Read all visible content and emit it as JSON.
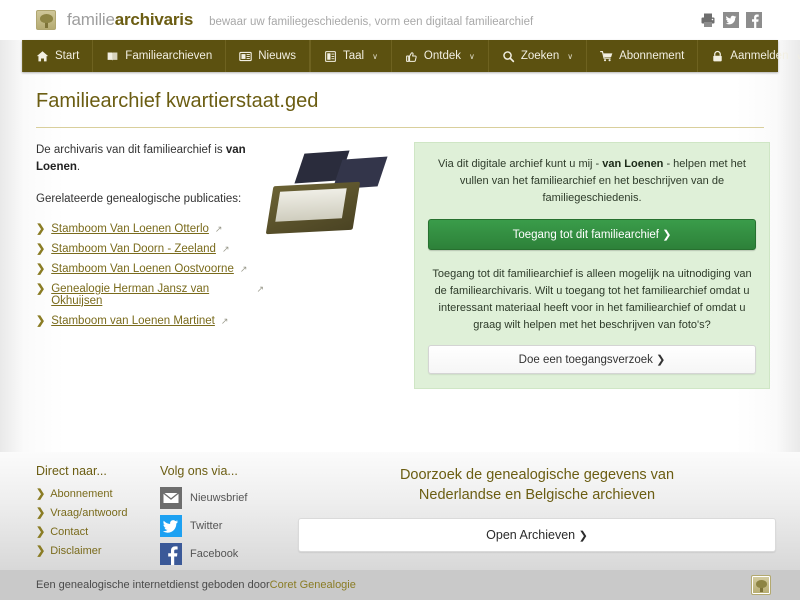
{
  "header": {
    "logo_icon": "tree-logo-icon",
    "brand_light": "familie",
    "brand_bold": "archivaris",
    "tagline": "bewaar uw familiegeschiedenis, vorm een digitaal familiearchief",
    "social": [
      {
        "name": "print-icon",
        "label": "Print"
      },
      {
        "name": "twitter-icon",
        "label": "Twitter"
      },
      {
        "name": "facebook-icon",
        "label": "Facebook"
      }
    ]
  },
  "nav": {
    "left": [
      {
        "icon": "home-icon",
        "label": "Start",
        "caret": false
      },
      {
        "icon": "book-icon",
        "label": "Familiearchieven",
        "caret": false
      },
      {
        "icon": "news-icon",
        "label": "Nieuws",
        "caret": false
      }
    ],
    "right": [
      {
        "icon": "language-icon",
        "label": "Taal",
        "caret": true
      },
      {
        "icon": "thumbs-up-icon",
        "label": "Ontdek",
        "caret": true
      },
      {
        "icon": "search-icon",
        "label": "Zoeken",
        "caret": true
      },
      {
        "icon": "cart-icon",
        "label": "Abonnement",
        "caret": false
      },
      {
        "icon": "lock-icon",
        "label": "Aanmelden",
        "caret": true
      }
    ],
    "caret_glyph": "∨"
  },
  "page_title": "Familiearchief kwartierstaat.ged",
  "left_column": {
    "intro_prefix": "De archivaris van dit familiearchief is ",
    "intro_strong": "van Loenen",
    "intro_suffix": ".",
    "publications_heading": "Gerelateerde genealogische publicaties:",
    "links": [
      "Stamboom Van Loenen Otterlo",
      "Stamboom Van Doorn - Zeeland",
      "Stamboom Van Loenen Oostvoorne",
      "Genealogie Herman Jansz van Okhuijsen",
      "Stamboom van Loenen Martinet"
    ],
    "chevron_glyph": "❯",
    "external_glyph": "↗"
  },
  "photo": {
    "alt": "archive-box-photo"
  },
  "panel": {
    "intro_prefix": "Via dit digitale archief kunt u mij - ",
    "intro_strong": "van Loenen",
    "intro_suffix": " - helpen met het vullen van het familiearchief en het beschrijven van de familiegeschiedenis.",
    "primary_button": "Toegang tot dit familiearchief",
    "body_text": "Toegang tot dit familiearchief is alleen mogelijk na uitnodiging van de familiearchivaris. Wilt u toegang tot het familiearchief omdat u interessant materiaal heeft voor in het familiearchief of omdat u graag wilt helpen met het beschrijven van foto's?",
    "secondary_button": "Doe een toegangsverzoek",
    "arrow_glyph": "❯",
    "green_bg": "#dff0d8",
    "green_button": "#2d8139"
  },
  "footer": {
    "direct_heading": "Direct naar...",
    "direct_links": [
      "Abonnement",
      "Vraag/antwoord",
      "Contact",
      "Disclaimer"
    ],
    "follow_heading": "Volg ons via...",
    "follow": [
      {
        "icon": "newsletter-icon",
        "label": "Nieuwsbrief"
      },
      {
        "icon": "twitter-icon",
        "label": "Twitter"
      },
      {
        "icon": "facebook-icon",
        "label": "Facebook"
      }
    ],
    "cta_line1": "Doorzoek de genealogische gegevens van",
    "cta_line2": "Nederlandse en Belgische archieven",
    "cta_button": "Open Archieven",
    "chevron_glyph": "❯"
  },
  "bottom": {
    "text": "Een genealogische internetdienst geboden door ",
    "link": "Coret Genealogie",
    "logo_icon": "tree-logo-icon"
  }
}
